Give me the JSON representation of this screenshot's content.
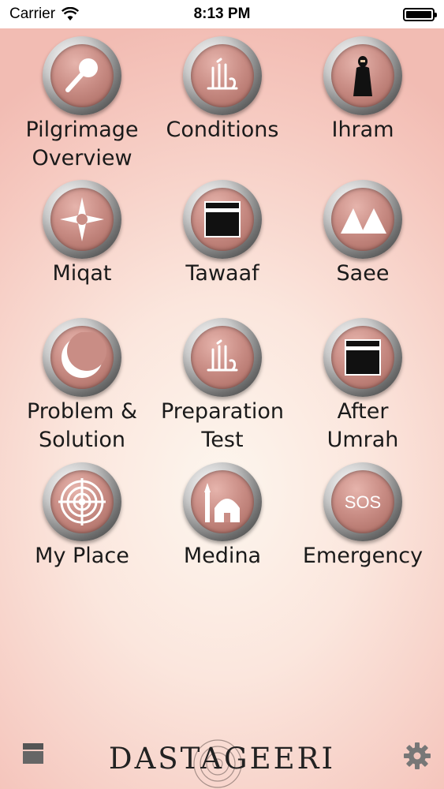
{
  "status": {
    "carrier": "Carrier",
    "time": "8:13 PM"
  },
  "tiles": [
    {
      "line1": "Pilgrimage",
      "line2": "Overview",
      "icon": "magnifier-icon"
    },
    {
      "line1": "Conditions",
      "line2": "",
      "icon": "allah-calligraphy-icon"
    },
    {
      "line1": "Ihram",
      "line2": "",
      "icon": "pilgrim-figure-icon"
    },
    {
      "line1": "Miqat",
      "line2": "",
      "icon": "compass-star-icon"
    },
    {
      "line1": "Tawaaf",
      "line2": "",
      "icon": "kaaba-icon"
    },
    {
      "line1": "Saee",
      "line2": "",
      "icon": "mountains-icon"
    },
    {
      "line1": "Problem &",
      "line2": "Solution",
      "icon": "crescent-icon"
    },
    {
      "line1": "Preparation",
      "line2": "Test",
      "icon": "allah-calligraphy-icon"
    },
    {
      "line1": "After",
      "line2": "Umrah",
      "icon": "kaaba-icon"
    },
    {
      "line1": "My Place",
      "line2": "",
      "icon": "target-icon"
    },
    {
      "line1": "Medina",
      "line2": "",
      "icon": "mosque-icon"
    },
    {
      "line1": "Emergency",
      "line2": "",
      "icon": "sos-icon",
      "icon_text": "SOS"
    }
  ],
  "footer": {
    "brand": "DASTAGEERI"
  }
}
